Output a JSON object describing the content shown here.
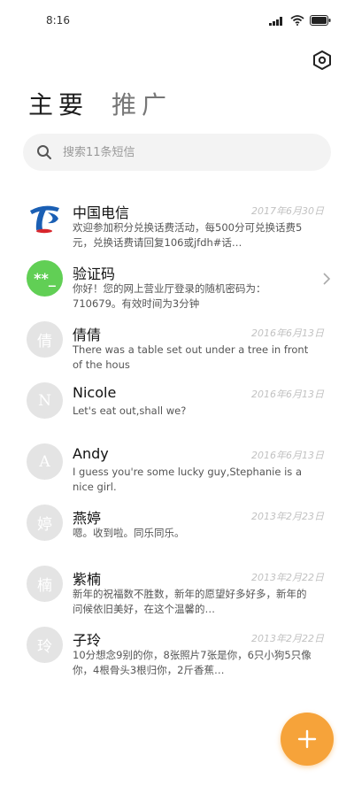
{
  "status_bar": {
    "time": "8:16"
  },
  "header": {
    "tab_primary": "主要",
    "tab_promo": "推广"
  },
  "search": {
    "placeholder": "搜索11条短信"
  },
  "messages": [
    {
      "avatar": "",
      "name": "中国电信",
      "date": "2017年6月30日",
      "preview": "欢迎参加积分兑换话费活动，每500分可兑换话费5元，兑换话费请回复106或jfdh#话…"
    },
    {
      "avatar": "**_",
      "name": "验证码",
      "date": "",
      "preview": "你好！您的网上营业厅登录的随机密码为：710679。有效时间为3分钟"
    },
    {
      "avatar": "倩",
      "name": "倩倩",
      "date": "2016年6月13日",
      "preview": "There was a table set out under a tree in front of the hous"
    },
    {
      "avatar": "N",
      "name": "Nicole",
      "date": "2016年6月13日",
      "preview": "Let's eat out,shall we?"
    },
    {
      "avatar": "A",
      "name": "Andy",
      "date": "2016年6月13日",
      "preview": "I guess you're some lucky guy,Stephanie is a nice girl."
    },
    {
      "avatar": "婷",
      "name": "燕婷",
      "date": "2013年2月23日",
      "preview": "嗯。收到啦。同乐同乐。"
    },
    {
      "avatar": "楠",
      "name": "紫楠",
      "date": "2013年2月22日",
      "preview": "新年的祝福数不胜数，新年的愿望好多好多，新年的问候依旧美好，在这个温馨的…"
    },
    {
      "avatar": "玲",
      "name": "子玲",
      "date": "2013年2月22日",
      "preview": "10分想念9别的你，8张照片7张是你，6只小狗5只像你，4根骨头3根归你，2斤香蕉…"
    }
  ],
  "colors": {
    "accent": "#f6a33a",
    "verification_avatar": "#61cf55",
    "telecom_blue": "#1a5fb4",
    "telecom_red": "#d8262c"
  },
  "icons": {
    "settings": "hexagon-gear-icon",
    "search": "search-icon",
    "chevron": "chevron-right-icon",
    "fab": "plus-icon"
  }
}
